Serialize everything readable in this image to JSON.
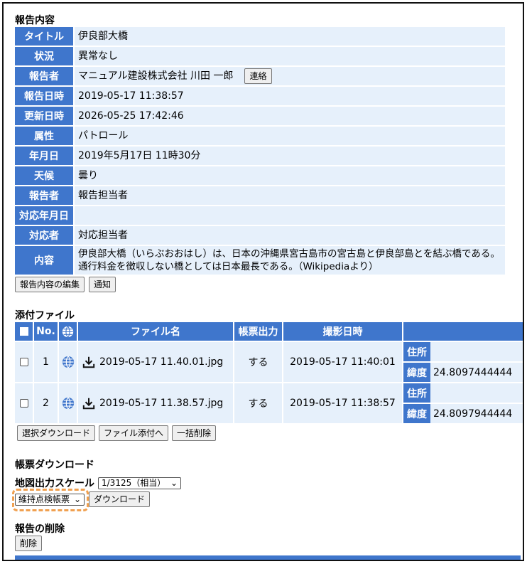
{
  "report": {
    "section_title": "報告内容",
    "rows": [
      {
        "label": "タイトル",
        "value": "伊良部大橋"
      },
      {
        "label": "状況",
        "value": "異常なし"
      },
      {
        "label": "報告者",
        "value": "マニュアル建設株式会社 川田 一郎"
      },
      {
        "label": "報告日時",
        "value": "2019-05-17 11:38:57"
      },
      {
        "label": "更新日時",
        "value": "2026-05-25 17:42:46"
      },
      {
        "label": "属性",
        "value": "パトロール"
      },
      {
        "label": "年月日",
        "value": "2019年5月17日 11時30分"
      },
      {
        "label": "天候",
        "value": "曇り"
      },
      {
        "label": "報告者",
        "value": "報告担当者"
      },
      {
        "label": "対応年月日",
        "value": ""
      },
      {
        "label": "対応者",
        "value": "対応担当者"
      },
      {
        "label": "内容",
        "value_line1": "伊良部大橋（いらぶおおはし）は、日本の沖縄県宮古島市の宮古島と伊良部島とを結ぶ橋である。",
        "value_line2": "通行料金を徴収しない橋としては日本最長である。（Wikipediaより）"
      }
    ],
    "contact_button": "連絡",
    "edit_button": "報告内容の編集",
    "notify_button": "通知"
  },
  "attachments": {
    "section_title": "添付ファイル",
    "headers": {
      "no": "No.",
      "file_name": "ファイル名",
      "form_output": "帳票出力",
      "shot_date": "撮影日時"
    },
    "rows": [
      {
        "no": "1",
        "file": "2019-05-17 11.40.01.jpg",
        "output": "する",
        "date": "2019-05-17 11:40:01",
        "address_label": "住所",
        "lat_label": "緯度",
        "lat_value": "24.8097444444"
      },
      {
        "no": "2",
        "file": "2019-05-17 11.38.57.jpg",
        "output": "する",
        "date": "2019-05-17 11:38:57",
        "address_label": "住所",
        "lat_label": "緯度",
        "lat_value": "24.8097944444"
      }
    ],
    "buttons": {
      "select_download": "選択ダウンロード",
      "attach": "ファイル添付へ",
      "bulk_delete": "一括削除"
    }
  },
  "form_download": {
    "section_title": "帳票ダウンロード",
    "scale_label": "地図出力スケール",
    "scale_value": "1/3125（相当）",
    "form_select_value": "維持点検帳票",
    "download_button": "ダウンロード"
  },
  "delete": {
    "section_title": "報告の削除",
    "delete_button": "削除"
  },
  "colors": {
    "header_blue": "#3f76cc",
    "row_bg": "#e6f0fb",
    "highlight": "#f0a050"
  }
}
